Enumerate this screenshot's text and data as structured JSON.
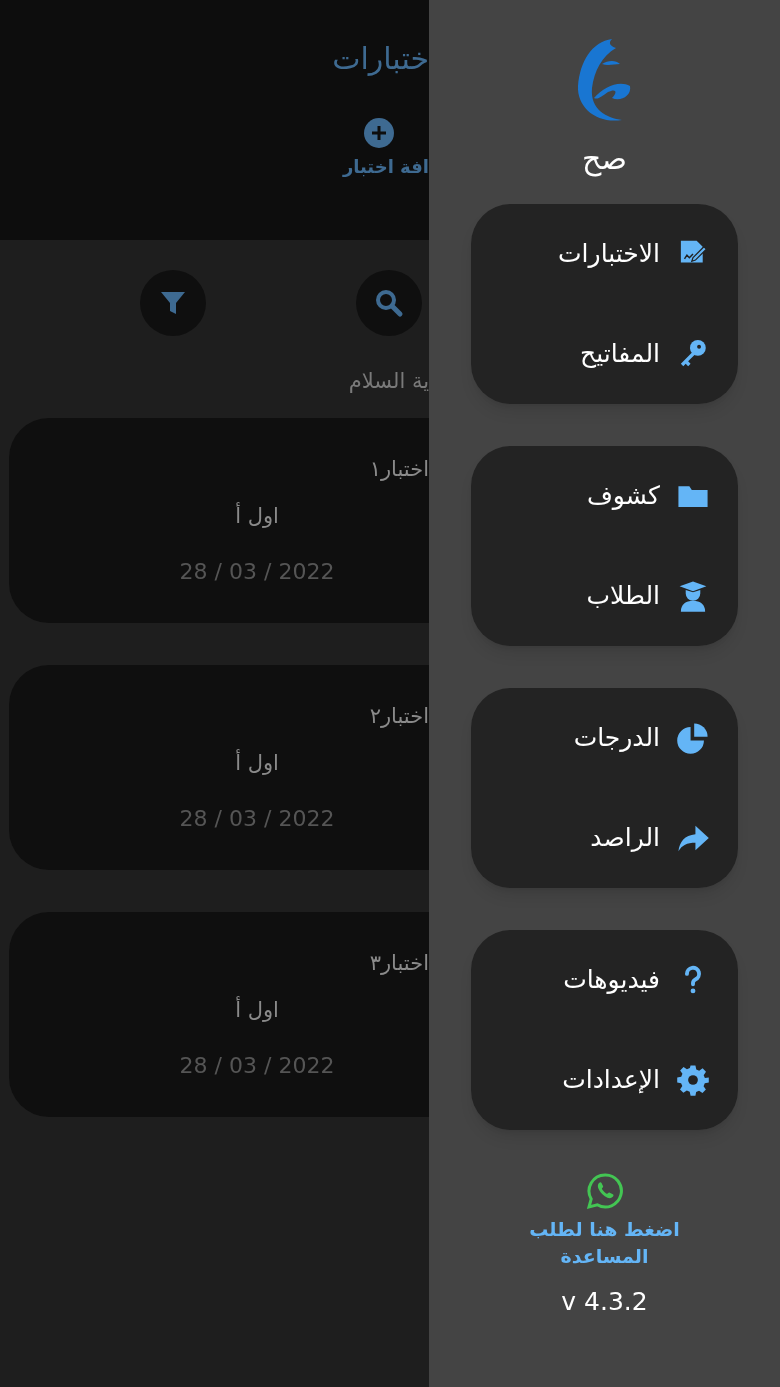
{
  "screen": {
    "title": "ختبارات",
    "add_button": "افة اختبار",
    "actions": [
      {
        "kind": "filter"
      },
      {
        "kind": "search"
      }
    ],
    "subtitle": "ية السلام",
    "cards": [
      {
        "title": "اختبار١",
        "class": "اول أ",
        "date": "28 / 03 / 2022"
      },
      {
        "title": "اختبار٢",
        "class": "اول أ",
        "date": "28 / 03 / 2022"
      },
      {
        "title": "اختبار٣",
        "class": "اول أ",
        "date": "28 / 03 / 2022"
      }
    ]
  },
  "drawer": {
    "app_name": "صح",
    "groups": [
      {
        "items": [
          {
            "kind": "exams",
            "label": "الاختبارات"
          },
          {
            "kind": "keys",
            "label": "المفاتيح"
          }
        ]
      },
      {
        "items": [
          {
            "kind": "folder",
            "label": "كشوف"
          },
          {
            "kind": "students",
            "label": "الطلاب"
          }
        ]
      },
      {
        "items": [
          {
            "kind": "grades",
            "label": "الدرجات"
          },
          {
            "kind": "share",
            "label": "الراصد"
          }
        ]
      },
      {
        "items": [
          {
            "kind": "help",
            "label": "فيديوهات"
          },
          {
            "kind": "settings",
            "label": "الإعدادات"
          }
        ]
      }
    ],
    "help_link": "اضغط هنا لطلب المساعدة",
    "version": "v 4.3.2"
  }
}
